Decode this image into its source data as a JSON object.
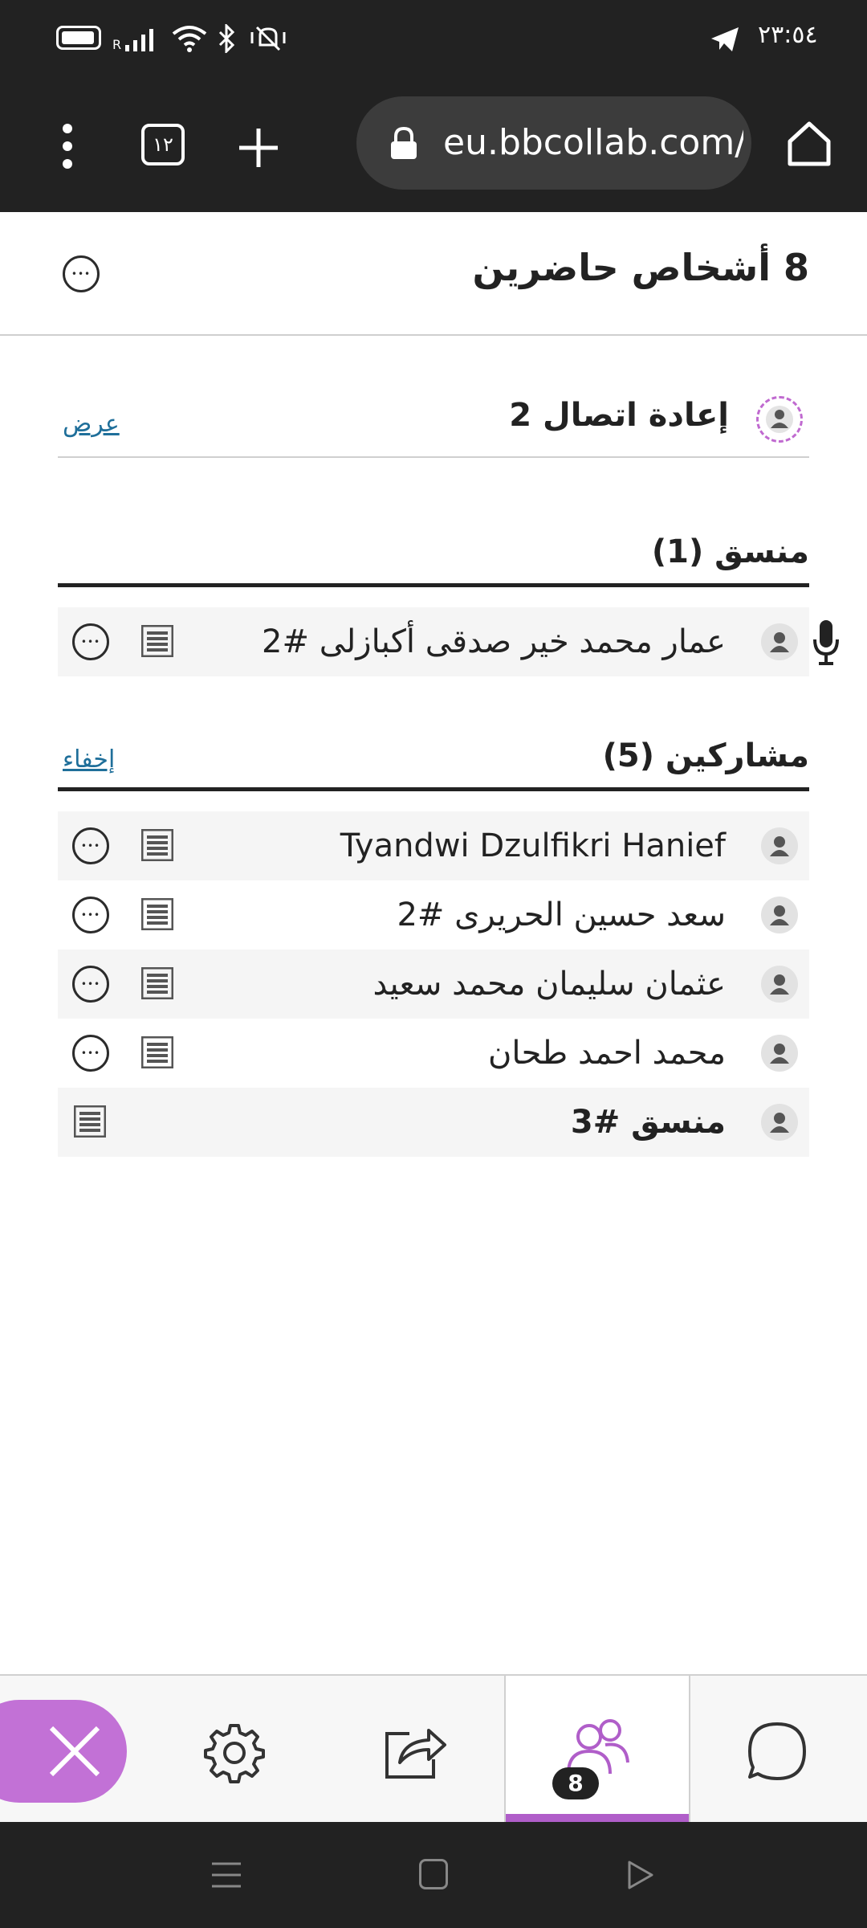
{
  "status_bar": {
    "time": "٢٣:٥٤",
    "signal_label": "R"
  },
  "browser": {
    "url": "eu.bbcollab.com/",
    "tab_count": "١٢"
  },
  "panel": {
    "title": "8 أشخاص حاضرين"
  },
  "reconnecting": {
    "label": "إعادة اتصال 2",
    "link": "عرض"
  },
  "moderator_section": {
    "heading": "منسق (1)",
    "members": [
      {
        "name": "عمار محمد خير صدقى أكبازلى #2"
      }
    ]
  },
  "participants_section": {
    "heading": "مشاركين (5)",
    "link": "إخفاء",
    "members": [
      {
        "name": "Tyandwi Dzulfikri Hanief"
      },
      {
        "name": "سعد حسين الحريرى #2"
      },
      {
        "name": "عثمان سليمان محمد سعيد"
      },
      {
        "name": "محمد احمد طحان"
      },
      {
        "name": "منسق #3"
      }
    ]
  },
  "bottom_nav": {
    "attendees_badge": "8",
    "accent_color": "#b05ec9"
  }
}
